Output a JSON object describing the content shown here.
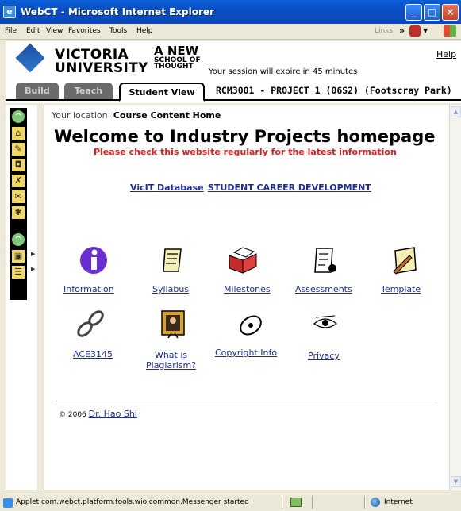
{
  "window": {
    "title": "WebCT - Microsoft Internet Explorer",
    "icon": "ie-icon"
  },
  "menu": {
    "items": [
      "File",
      "Edit",
      "View",
      "Favorites",
      "Tools",
      "Help"
    ],
    "links": "Links",
    "chevron": "»"
  },
  "header": {
    "logo_line1": "VICTORIA",
    "logo_line2": "UNIVERSITY",
    "slogan_line1": "A NEW",
    "slogan_line2": "SCHOOL OF",
    "slogan_line3": "THOUGHT",
    "session": "Your session will expire in 45 minutes",
    "help": "Help"
  },
  "tabs": {
    "build": "Build",
    "teach": "Teach",
    "student_view": "Student View",
    "course": "RCM3001 - PROJECT 1 (06S2) (Footscray Park)"
  },
  "content": {
    "location_label": "Your location:",
    "location_value": "Course Content Home",
    "heading": "Welcome to Industry Projects homepage",
    "subheading": "Please check this website regularly for the latest information",
    "links": [
      "VicIT Database",
      "STUDENT CAREER DEVELOPMENT"
    ],
    "icons_row1": [
      {
        "label": "Information",
        "icon": "info-icon"
      },
      {
        "label": "Syllabus",
        "icon": "scroll-icon"
      },
      {
        "label": "Milestones",
        "icon": "book-icon"
      },
      {
        "label": "Assessments",
        "icon": "checklist-icon"
      },
      {
        "label": "Template",
        "icon": "pen-paper-icon"
      }
    ],
    "icons_row2": [
      {
        "label": "ACE3145",
        "icon": "chain-icon"
      },
      {
        "label_line1": "What is",
        "label_line2": "Plagiarism?",
        "icon": "portrait-icon"
      },
      {
        "label": "Copyright Info",
        "icon": "cd-icon"
      },
      {
        "label": "Privacy",
        "icon": "eye-icon"
      }
    ],
    "copyright_prefix": "© 2006",
    "copyright_link": "Dr. Hao Shi"
  },
  "status": {
    "text": "Applet com.webct.platform.tools.wio.common.Messenger started",
    "zone": "Internet"
  },
  "colors": {
    "link": "#1d2c9a",
    "alert": "#e81a1a",
    "titlebar": "#0b4fc4"
  }
}
